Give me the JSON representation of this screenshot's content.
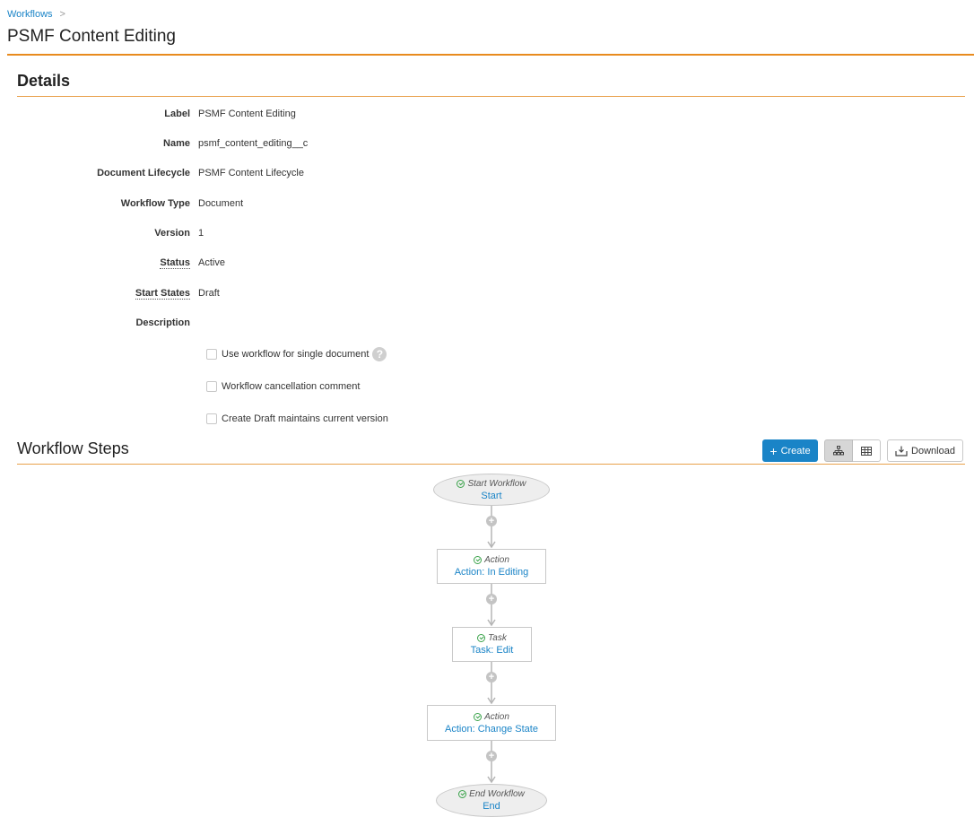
{
  "breadcrumb": {
    "parent": "Workflows",
    "separator": ">"
  },
  "page_title": "PSMF Content Editing",
  "details": {
    "section_title": "Details",
    "fields": {
      "label": {
        "label": "Label",
        "value": "PSMF Content Editing"
      },
      "name": {
        "label": "Name",
        "value": "psmf_content_editing__c"
      },
      "document_lifecycle": {
        "label": "Document Lifecycle",
        "value": "PSMF Content Lifecycle"
      },
      "workflow_type": {
        "label": "Workflow Type",
        "value": "Document"
      },
      "version": {
        "label": "Version",
        "value": "1"
      },
      "status": {
        "label": "Status",
        "value": "Active"
      },
      "start_states": {
        "label": "Start States",
        "value": "Draft"
      },
      "description": {
        "label": "Description",
        "value": ""
      }
    },
    "options": {
      "single_document": {
        "label": "Use workflow for single document",
        "checked": false
      },
      "cancellation_comment": {
        "label": "Workflow cancellation comment",
        "checked": false
      },
      "create_draft": {
        "label": "Create Draft maintains current version",
        "checked": false
      }
    }
  },
  "workflow_steps": {
    "section_title": "Workflow Steps",
    "create_label": "Create",
    "download_label": "Download",
    "view_mode": "diagram",
    "nodes": [
      {
        "type": "Start Workflow",
        "name": "Start"
      },
      {
        "type": "Action",
        "name": "Action: In Editing"
      },
      {
        "type": "Task",
        "name": "Task: Edit"
      },
      {
        "type": "Action",
        "name": "Action: Change State"
      },
      {
        "type": "End Workflow",
        "name": "End"
      }
    ]
  },
  "colors": {
    "accent": "#e88b1e",
    "link": "#1a84c7",
    "primary_button": "#1a84c7",
    "check": "#3aa34a"
  }
}
